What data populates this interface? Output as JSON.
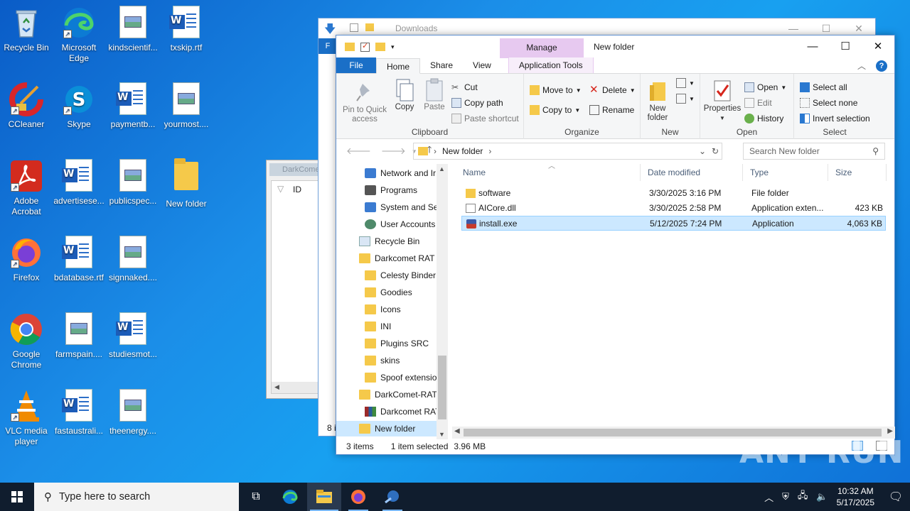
{
  "desktop": {
    "icons": [
      {
        "label": "Recycle Bin",
        "icon": "recycle-bin-icon"
      },
      {
        "label": "Microsoft Edge",
        "icon": "edge-icon"
      },
      {
        "label": "kindscientif...",
        "icon": "image-file-icon"
      },
      {
        "label": "txskip.rtf",
        "icon": "word-doc-icon"
      },
      {
        "label": "CCleaner",
        "icon": "ccleaner-icon"
      },
      {
        "label": "Skype",
        "icon": "skype-icon"
      },
      {
        "label": "paymentb...",
        "icon": "word-doc-icon"
      },
      {
        "label": "yourmost....",
        "icon": "image-file-icon"
      },
      {
        "label": "Adobe Acrobat",
        "icon": "acrobat-icon"
      },
      {
        "label": "advertisese...",
        "icon": "word-doc-icon"
      },
      {
        "label": "publicspec...",
        "icon": "image-file-icon"
      },
      {
        "label": "New folder",
        "icon": "folder-icon"
      },
      {
        "label": "Firefox",
        "icon": "firefox-icon"
      },
      {
        "label": "bdatabase.rtf",
        "icon": "word-doc-icon"
      },
      {
        "label": "signnaked....",
        "icon": "image-file-icon"
      },
      {
        "label": "Google Chrome",
        "icon": "chrome-icon"
      },
      {
        "label": "farmspain....",
        "icon": "image-file-icon"
      },
      {
        "label": "studiesmot...",
        "icon": "word-doc-icon"
      },
      {
        "label": "VLC media player",
        "icon": "vlc-icon"
      },
      {
        "label": "fastaustrali...",
        "icon": "word-doc-icon"
      },
      {
        "label": "theenergy....",
        "icon": "image-file-icon"
      }
    ]
  },
  "back_window": {
    "title": "Downloads",
    "file_tab": "F",
    "status": "8 i",
    "controls": [
      "—",
      "☐",
      "✕"
    ]
  },
  "darkcomet_window": {
    "caption": "DarkComet",
    "column_header": "ID"
  },
  "explorer": {
    "title": "New folder",
    "manage_tab": "Manage",
    "controls": [
      "—",
      "☐",
      "✕"
    ],
    "tabs": {
      "file": "File",
      "home": "Home",
      "share": "Share",
      "view": "View",
      "app_tools": "Application Tools"
    },
    "ribbon": {
      "clipboard": {
        "group": "Clipboard",
        "pin": "Pin to Quick access",
        "copy": "Copy",
        "paste": "Paste",
        "cut": "Cut",
        "copy_path": "Copy path",
        "paste_shortcut": "Paste shortcut"
      },
      "organize": {
        "group": "Organize",
        "move_to": "Move to",
        "copy_to": "Copy to",
        "delete": "Delete",
        "rename": "Rename"
      },
      "new": {
        "group": "New",
        "new_folder": "New folder"
      },
      "open": {
        "group": "Open",
        "properties": "Properties",
        "open": "Open",
        "edit": "Edit",
        "history": "History"
      },
      "select": {
        "group": "Select",
        "select_all": "Select all",
        "select_none": "Select none",
        "invert": "Invert selection"
      }
    },
    "address": {
      "path": "New folder",
      "search_placeholder": "Search New folder"
    },
    "nav": [
      {
        "label": "Network and Ir",
        "icon": "sys",
        "indent": 40
      },
      {
        "label": "Programs",
        "icon": "prog",
        "indent": 40
      },
      {
        "label": "System and Se",
        "icon": "sys",
        "indent": 40
      },
      {
        "label": "User Accounts",
        "icon": "usr",
        "indent": 40
      },
      {
        "label": "Recycle Bin",
        "icon": "rb",
        "indent": 32
      },
      {
        "label": "Darkcomet RAT !",
        "icon": "fold",
        "indent": 32
      },
      {
        "label": "Celesty Binder",
        "icon": "fold",
        "indent": 40
      },
      {
        "label": "Goodies",
        "icon": "fold",
        "indent": 40
      },
      {
        "label": "Icons",
        "icon": "fold",
        "indent": 40
      },
      {
        "label": "INI",
        "icon": "fold",
        "indent": 40
      },
      {
        "label": "Plugins SRC",
        "icon": "fold",
        "indent": 40
      },
      {
        "label": "skins",
        "icon": "fold",
        "indent": 40
      },
      {
        "label": "Spoof extensio",
        "icon": "fold",
        "indent": 40
      },
      {
        "label": "DarkComet-RAT",
        "icon": "fold",
        "indent": 32
      },
      {
        "label": "Darkcomet RAT",
        "icon": "rar",
        "indent": 40
      },
      {
        "label": "New folder",
        "icon": "fold",
        "indent": 32
      }
    ],
    "columns": {
      "name": "Name",
      "date": "Date modified",
      "type": "Type",
      "size": "Size"
    },
    "files": [
      {
        "name": "software",
        "date": "3/30/2025 3:16 PM",
        "type": "File folder",
        "size": "",
        "icon": "fold"
      },
      {
        "name": "AICore.dll",
        "date": "3/30/2025 2:58 PM",
        "type": "Application exten...",
        "size": "423 KB",
        "icon": "dll"
      },
      {
        "name": "install.exe",
        "date": "5/12/2025 7:24 PM",
        "type": "Application",
        "size": "4,063 KB",
        "icon": "exe"
      }
    ],
    "status": {
      "items": "3 items",
      "selected": "1 item selected",
      "size": "3.96 MB"
    }
  },
  "watermark": "ANY RUN",
  "taskbar": {
    "search_placeholder": "Type here to search",
    "time": "10:32 AM",
    "date": "5/17/2025"
  }
}
